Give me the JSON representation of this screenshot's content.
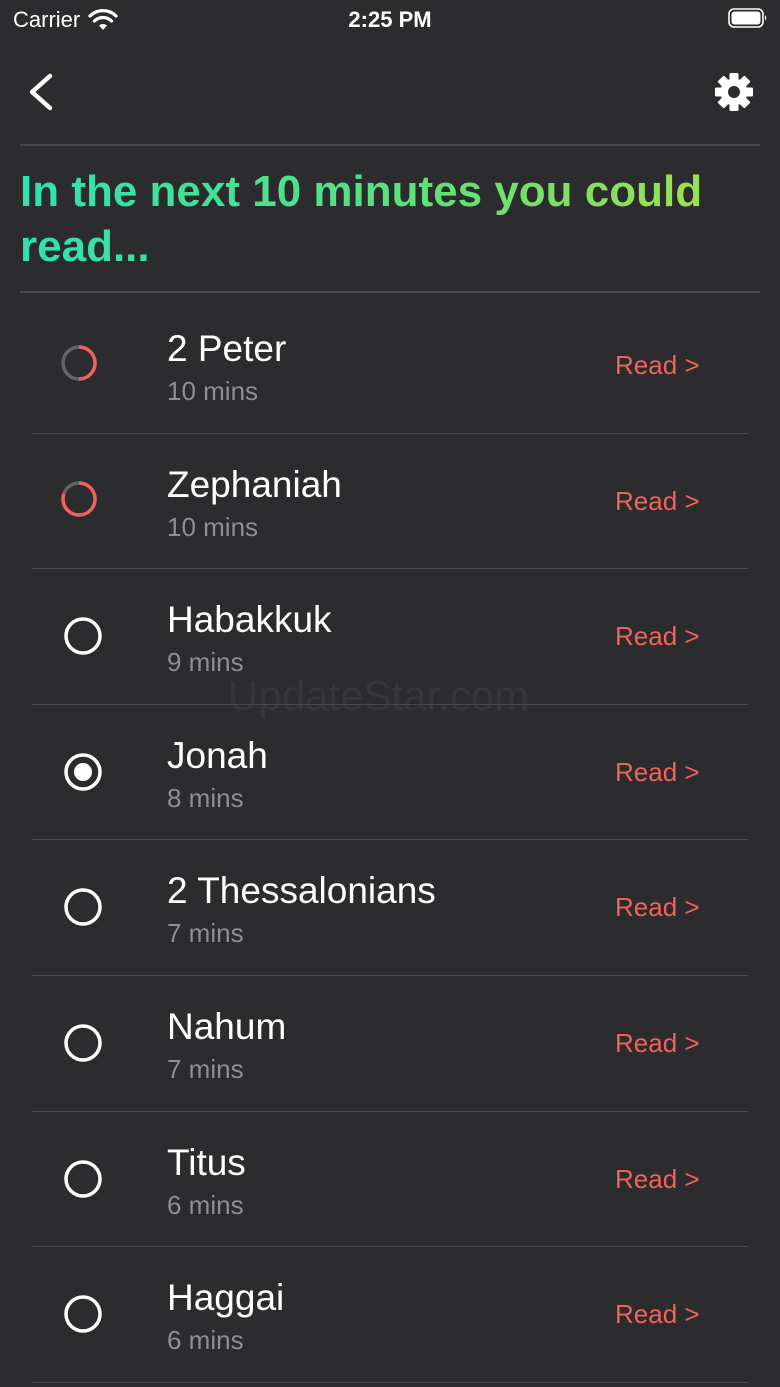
{
  "status_bar": {
    "carrier": "Carrier",
    "time": "2:25 PM"
  },
  "nav": {
    "back_icon": "chevron-left-icon",
    "settings_icon": "gear-icon"
  },
  "heading": "In the next 10 minutes you could read...",
  "colors": {
    "background": "#2c2c2e",
    "heading_gradient_start": "#2de2b2",
    "heading_gradient_end": "#a8e04a",
    "read_link": "#f0625c",
    "progress_red": "#f0625c",
    "subtitle": "#8e8e93"
  },
  "books": [
    {
      "title": "2 Peter",
      "time": "10 mins",
      "read_label": "Read >",
      "state": "in-progress",
      "progress": 0.5
    },
    {
      "title": "Zephaniah",
      "time": "10 mins",
      "read_label": "Read >",
      "state": "in-progress",
      "progress": 0.8
    },
    {
      "title": "Habakkuk",
      "time": "9 mins",
      "read_label": "Read >",
      "state": "unread",
      "progress": 0
    },
    {
      "title": "Jonah",
      "time": "8 mins",
      "read_label": "Read >",
      "state": "selected",
      "progress": 0
    },
    {
      "title": "2 Thessalonians",
      "time": "7 mins",
      "read_label": "Read >",
      "state": "unread",
      "progress": 0
    },
    {
      "title": "Nahum",
      "time": "7 mins",
      "read_label": "Read >",
      "state": "unread",
      "progress": 0
    },
    {
      "title": "Titus",
      "time": "6 mins",
      "read_label": "Read >",
      "state": "unread",
      "progress": 0
    },
    {
      "title": "Haggai",
      "time": "6 mins",
      "read_label": "Read >",
      "state": "unread",
      "progress": 0
    }
  ],
  "watermark": "UpdateStar.com"
}
